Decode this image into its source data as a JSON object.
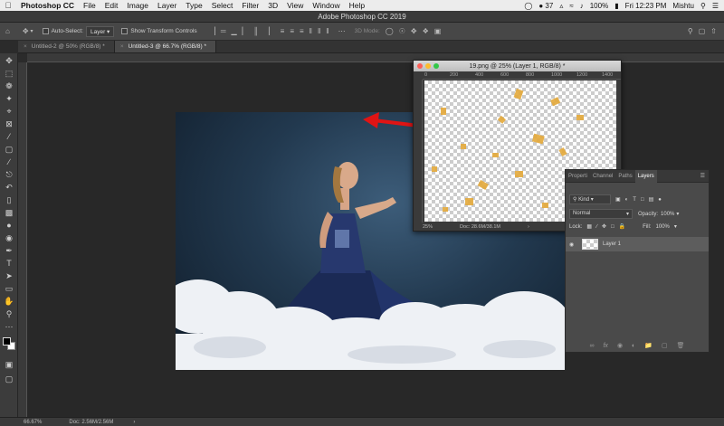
{
  "menubar": {
    "app_name": "Photoshop CC",
    "items": [
      "File",
      "Edit",
      "Image",
      "Layer",
      "Type",
      "Select",
      "Filter",
      "3D",
      "View",
      "Window",
      "Help"
    ],
    "battery_badge": "37",
    "battery_percent": "100%",
    "clock": "Fri 12:23 PM",
    "user": "Mishtu"
  },
  "window": {
    "title": "Adobe Photoshop CC 2019"
  },
  "options_bar": {
    "auto_select_label": "Auto-Select:",
    "auto_select_value": "Layer",
    "transform_controls_label": "Show Transform Controls",
    "mode_3d_label": "3D Mode:"
  },
  "tabs": [
    {
      "label": "Untitled-2 @ 50% (RGB/8) *",
      "active": false
    },
    {
      "label": "Untitled-3 @ 66.7% (RGB/8) *",
      "active": true
    }
  ],
  "status_bar": {
    "zoom": "66.67%",
    "doc": "Doc: 2.56M/2.56M"
  },
  "float_window": {
    "title": "19.png @ 25% (Layer 1, RGB/8) *",
    "ruler_labels": [
      "0",
      "200",
      "400",
      "600",
      "800",
      "1000",
      "1200",
      "1400"
    ],
    "zoom": "25%",
    "doc": "Doc: 28.6M/38.1M"
  },
  "layers_panel": {
    "tabs": [
      "Properti",
      "Channel",
      "Paths",
      "Layers"
    ],
    "active_tab": "Layers",
    "filter_kind": "Kind",
    "blend_mode": "Normal",
    "opacity_label": "Opacity:",
    "opacity_value": "100%",
    "lock_label": "Lock:",
    "fill_label": "Fill:",
    "fill_value": "100%",
    "layers": [
      {
        "name": "Layer 1",
        "visible": true
      }
    ]
  },
  "colors": {
    "arrow": "#e01414",
    "accent_window_close": "#fc5f57",
    "accent_window_min": "#fdbc2e",
    "accent_window_max": "#33c748"
  }
}
